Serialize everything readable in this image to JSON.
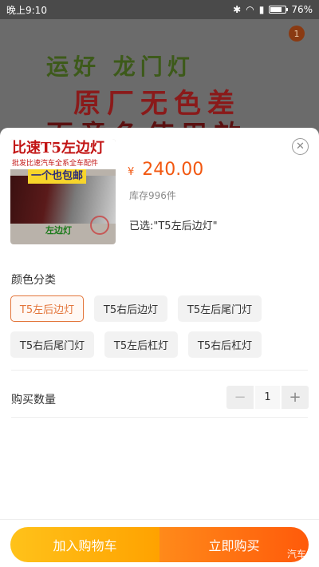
{
  "status_bar": {
    "time": "晚上9:10",
    "battery": "76%",
    "battery_level": 0.76
  },
  "background": {
    "banner_line1": "运好 龙门灯",
    "banner_line2": "原厂无色差",
    "banner_line3": "百意色使用效",
    "badge": "1"
  },
  "product": {
    "thumb_title": "比速T5左边灯",
    "thumb_subtitle": "批发比速汽车全系全车配件",
    "thumb_banner": "一个也包邮",
    "thumb_caption": "左边灯",
    "currency": "¥",
    "price": "240.00",
    "stock": "库存996件",
    "selected": "已选:\"T5左后边灯\""
  },
  "variant_section": {
    "title": "颜色分类",
    "options": [
      {
        "label": "T5左后边灯",
        "active": true
      },
      {
        "label": "T5右后边灯",
        "active": false
      },
      {
        "label": "T5左后尾门灯",
        "active": false
      },
      {
        "label": "T5右后尾门灯",
        "active": false
      },
      {
        "label": "T5左后杠灯",
        "active": false
      },
      {
        "label": "T5右后杠灯",
        "active": false
      }
    ]
  },
  "quantity": {
    "label": "购买数量",
    "value": "1",
    "minus": "−",
    "plus": "+"
  },
  "actions": {
    "add_to_cart": "加入购物车",
    "buy_now": "立即购买"
  },
  "watermark": "汽车之",
  "colors": {
    "accent": "#f25811",
    "cart_btn": "#ffb20f",
    "buy_btn": "#ff6a10"
  }
}
